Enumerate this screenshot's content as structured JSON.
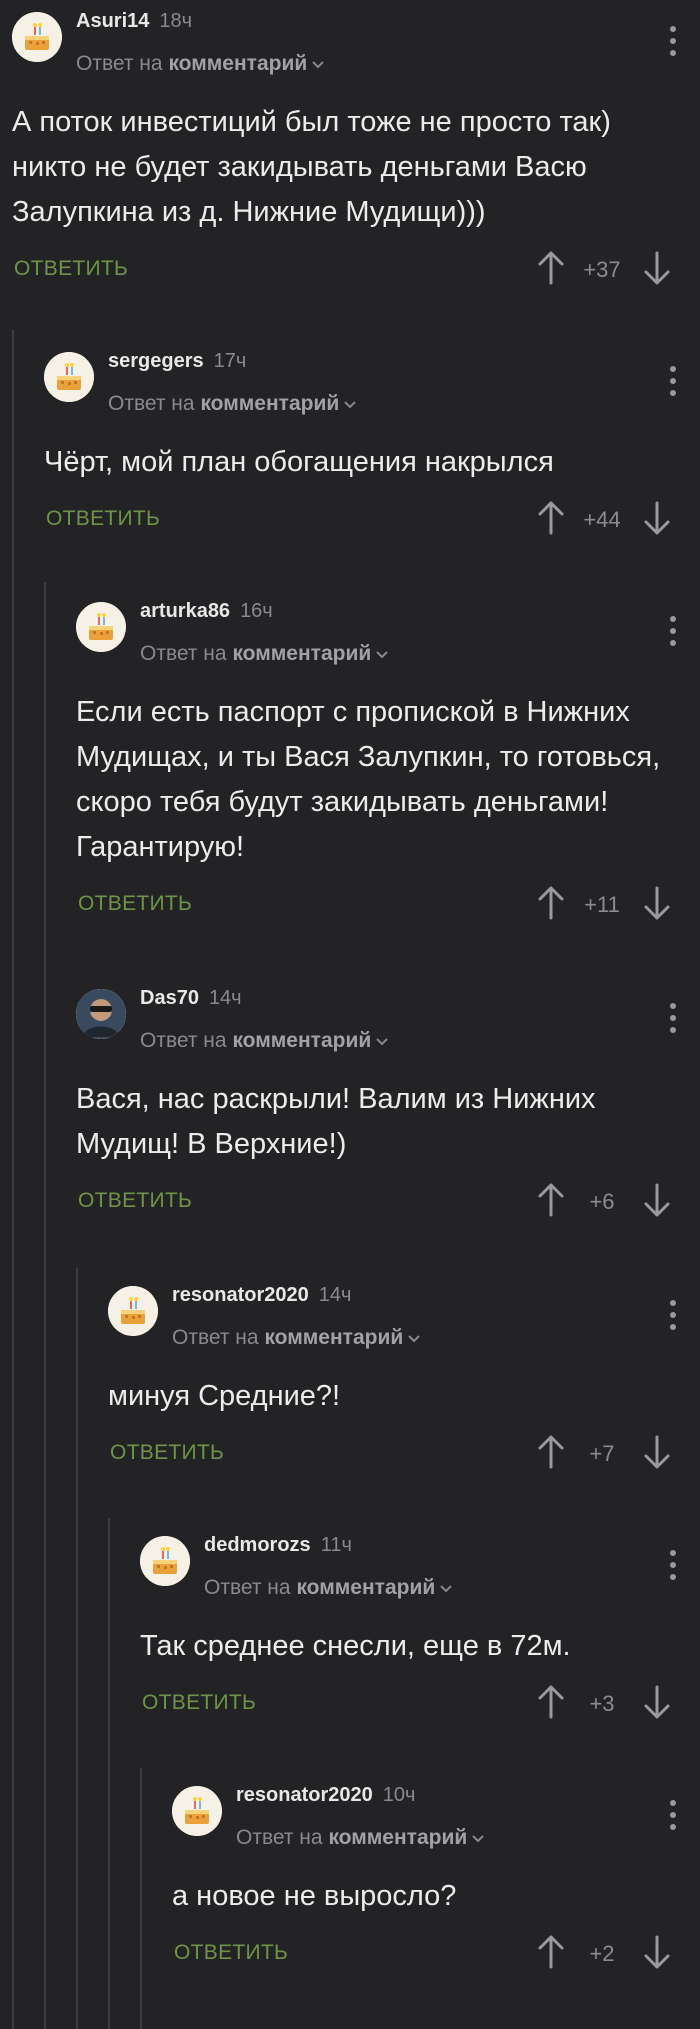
{
  "reply_prefix": "Ответ на",
  "reply_target": "комментарий",
  "reply_button": "ОТВЕТИТЬ",
  "colors": {
    "background": "#232326",
    "accent": "#6f9447",
    "muted": "#8a8a8e"
  },
  "comments": [
    {
      "user": "Asuri14",
      "time": "18ч",
      "text": "А поток инвестиций был тоже не просто так) никто не будет закидывать деньгами Васю Залупкина из д. Нижние Мудищи)))",
      "score": "+37",
      "avatar": "cake-icon"
    },
    {
      "user": "sergegers",
      "time": "17ч",
      "text": "Чёрт, мой план обогащения накрылся",
      "score": "+44",
      "avatar": "cake-icon"
    },
    {
      "user": "arturka86",
      "time": "16ч",
      "text": "Если есть паспорт с пропиской в Нижних Мудищах, и ты Вася Залупкин, то готовься, скоро тебя будут закидывать деньгами! Гарантирую!",
      "score": "+11",
      "avatar": "cake-icon"
    },
    {
      "user": "Das70",
      "time": "14ч",
      "text": "Вася, нас раскрыли! Валим из Нижних Мудищ! В Верхние!)",
      "score": "+6",
      "avatar": "user-photo"
    },
    {
      "user": "resonator2020",
      "time": "14ч",
      "text": "минуя Средние?!",
      "score": "+7",
      "avatar": "cake-icon"
    },
    {
      "user": "dedmorozs",
      "time": "11ч",
      "text": "Так среднее снесли, еще в 72м.",
      "score": "+3",
      "avatar": "cake-icon"
    },
    {
      "user": "resonator2020",
      "time": "10ч",
      "text": "а новое не выросло?",
      "score": "+2",
      "avatar": "cake-icon"
    }
  ]
}
